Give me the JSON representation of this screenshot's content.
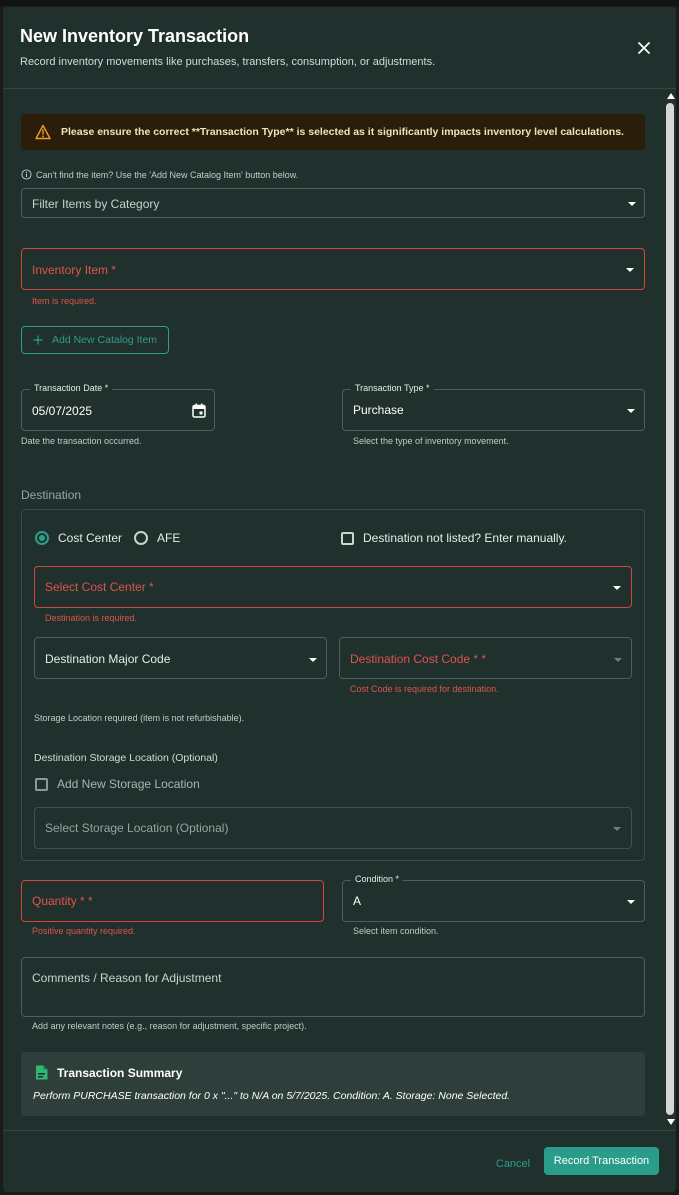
{
  "dialog": {
    "title": "New Inventory Transaction",
    "subtitle": "Record inventory movements like purchases, transfers, consumption, or adjustments.",
    "close_icon": "close-icon"
  },
  "warning": {
    "icon": "warning-triangle-icon",
    "text": "Please ensure the correct **Transaction Type** is selected as it significantly impacts inventory level calculations."
  },
  "item_hint": {
    "icon": "info-icon",
    "text": "Can't find the item? Use the 'Add New Catalog Item' button below."
  },
  "category_filter": {
    "placeholder": "Filter Items by Category"
  },
  "inventory_item": {
    "label": "Inventory Item *",
    "error": "Item is required."
  },
  "add_catalog_button": {
    "icon": "plus-icon",
    "label": "Add New Catalog Item"
  },
  "transaction_date": {
    "label": "Transaction Date *",
    "value": "05/07/2025",
    "icon": "calendar-icon",
    "help": "Date the transaction occurred."
  },
  "transaction_type": {
    "label": "Transaction Type *",
    "value": "Purchase",
    "help": "Select the type of inventory movement."
  },
  "destination": {
    "section_label": "Destination",
    "radio_cost_center": "Cost Center",
    "radio_afe": "AFE",
    "selected_radio": "Cost Center",
    "manual_checkbox_label": "Destination not listed? Enter manually.",
    "cost_center": {
      "label": "Select Cost Center *",
      "error": "Destination is required."
    },
    "major_code": {
      "label": "Destination Major Code"
    },
    "cost_code": {
      "label": "Destination Cost Code * *",
      "error": "Cost Code is required for destination."
    },
    "storage_note": "Storage Location required (item is not refurbishable).",
    "storage_heading": "Destination Storage Location (Optional)",
    "add_storage_label": "Add New Storage Location",
    "storage_select": {
      "placeholder": "Select Storage Location (Optional)"
    }
  },
  "quantity": {
    "label": "Quantity * *",
    "error": "Positive quantity required."
  },
  "condition": {
    "label": "Condition *",
    "value": "A",
    "help": "Select item condition."
  },
  "comments": {
    "placeholder": "Comments / Reason for Adjustment",
    "help": "Add any relevant notes (e.g., reason for adjustment, specific project)."
  },
  "summary": {
    "icon": "document-icon",
    "title": "Transaction Summary",
    "text": "Perform PURCHASE transaction for 0 x \"...\" to N/A on 5/7/2025. Condition: A. Storage: None Selected."
  },
  "footer": {
    "cancel_label": "Cancel",
    "record_label": "Record Transaction"
  },
  "colors": {
    "accent": "#2a9d8a",
    "error": "#d6453a",
    "surface": "#1f302d",
    "warning_bg": "#2a1e0b"
  }
}
